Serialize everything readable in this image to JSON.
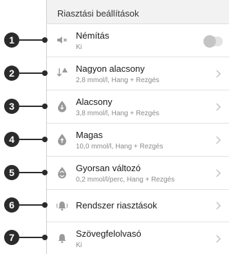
{
  "header": {
    "title": "Riasztási beállítások"
  },
  "rows": [
    {
      "title": "Némítás",
      "subtitle": "Ki"
    },
    {
      "title": "Nagyon alacsony",
      "subtitle": "2,8 mmol/l, Hang + Rezgés"
    },
    {
      "title": "Alacsony",
      "subtitle": "3,8 mmol/l, Hang + Rezgés"
    },
    {
      "title": "Magas",
      "subtitle": "10,0 mmol/l, Hang + Rezgés"
    },
    {
      "title": "Gyorsan változó",
      "subtitle": "0,2 mmol/l/perc,  Hang + Rezgés"
    },
    {
      "title": "Rendszer riasztások"
    },
    {
      "title": "Szövegfelolvasó",
      "subtitle": "Ki"
    }
  ],
  "mute_toggle": {
    "on": false
  },
  "callouts": [
    "1",
    "2",
    "3",
    "4",
    "5",
    "6",
    "7"
  ],
  "colors": {
    "icon": "#9a9a9a",
    "callout": "#2b2b2b",
    "chevron": "#c2c2c2"
  }
}
